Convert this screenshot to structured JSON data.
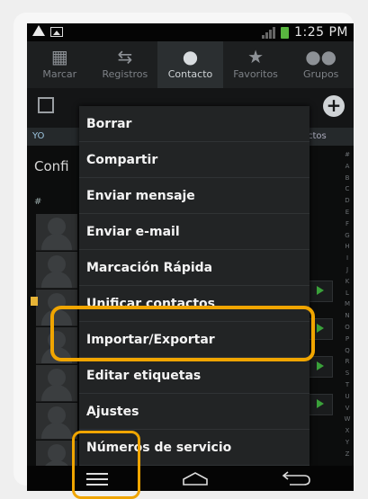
{
  "status": {
    "time": "1:25 PM"
  },
  "tabs": [
    {
      "label": "Marcar",
      "icon": "dialpad-icon",
      "glyph": "▦"
    },
    {
      "label": "Registros",
      "icon": "call-log-icon",
      "glyph": "⇆"
    },
    {
      "label": "Contacto",
      "icon": "contact-icon",
      "glyph": "●"
    },
    {
      "label": "Favoritos",
      "icon": "star-icon",
      "glyph": "★"
    },
    {
      "label": "Grupos",
      "icon": "groups-icon",
      "glyph": "●●"
    }
  ],
  "active_tab": "Contacto",
  "background": {
    "section_left": "YO",
    "section_right": "ctos",
    "config_text": "Confi",
    "hash": "#",
    "alphabet": [
      "#",
      "A",
      "B",
      "C",
      "D",
      "E",
      "F",
      "G",
      "H",
      "I",
      "J",
      "K",
      "L",
      "M",
      "N",
      "O",
      "P",
      "Q",
      "R",
      "S",
      "T",
      "U",
      "V",
      "W",
      "X",
      "Y",
      "Z"
    ]
  },
  "menu": {
    "items": [
      "Borrar",
      "Compartir",
      "Enviar mensaje",
      "Enviar e-mail",
      "Marcación Rápida",
      "Unificar contactos",
      "Importar/Exportar",
      "Editar etiquetas",
      "Ajustes",
      "Números de servicio"
    ]
  },
  "colors": {
    "highlight": "#f0a500",
    "call_green": "#3aa13a",
    "battery_green": "#58b53f"
  }
}
